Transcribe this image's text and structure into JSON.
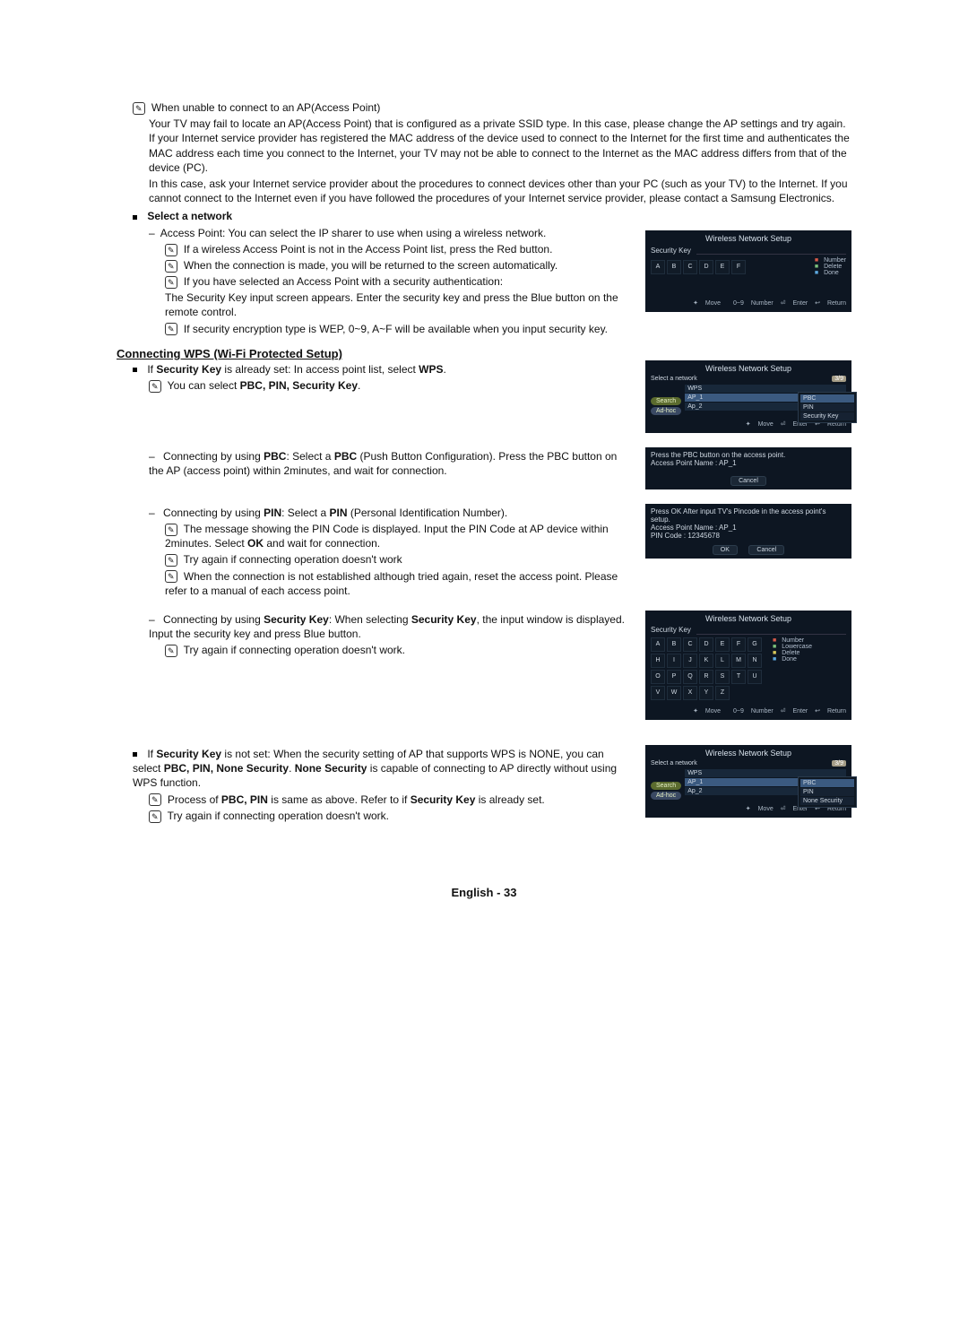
{
  "note_glyph": "✎",
  "top": {
    "unable_title": "When unable to connect to an AP(Access Point)",
    "unable_para1": "Your TV may fail to locate an AP(Access Point) that is configured as a private SSID type. In this case, please change the AP settings and try again. If your Internet service provider has registered the MAC address of the device used to connect to the Internet for the first time and authenticates the MAC address each time you connect to the Internet, your TV may not be able to connect to the Internet as the MAC address differs from that of the device (PC).",
    "unable_para2": "In this case, ask your Internet service provider about the procedures to connect devices other than your PC (such as your TV) to the Internet. If you cannot connect to the Internet even if you have followed the procedures of your Internet service provider, please contact a Samsung Electronics."
  },
  "select_network": {
    "title": "Select a network",
    "ap_line": "Access Point: You can select the IP sharer to use when using a wireless network.",
    "n1": "If a wireless Access Point is not in the Access Point list, press the Red button.",
    "n2": "When the connection is made, you will be returned to the screen automatically.",
    "n3a": "If you have selected an Access Point with a security authentication:",
    "n3b": "The Security Key input screen appears. Enter the security key and press the Blue button on the remote control.",
    "n4": "If security encryption type is WEP, 0~9, A~F will be available when you input security key."
  },
  "wps": {
    "heading": "Connecting WPS (Wi-Fi Protected Setup)",
    "intro_pre": "If ",
    "intro_bold1": "Security Key",
    "intro_mid": " is already set: In access point list, select ",
    "intro_bold2": "WPS",
    "intro_post": ".",
    "note_select": "You can select ",
    "note_select_bold": "PBC, PIN, Security Key",
    "pbc_pre": "Connecting by using ",
    "pbc_b1": "PBC",
    "pbc_mid": ": Select a ",
    "pbc_b2": "PBC",
    "pbc_post": " (Push Button Configuration). Press the PBC button on the AP (access point) within 2minutes, and wait for connection.",
    "pin_pre": "Connecting by using ",
    "pin_b1": "PIN",
    "pin_mid": ": Select a ",
    "pin_b2": "PIN",
    "pin_post": " (Personal Identification Number).",
    "pin_n1a": "The message showing the PIN Code is displayed. Input the PIN Code at AP device within 2minutes. Select ",
    "pin_n1b": "OK",
    "pin_n1c": " and wait for connection.",
    "try_again": "Try again if connecting operation doesn't work",
    "reset_note": "When the connection is not established although tried again, reset the access point. Please refer to a manual of each access point.",
    "sk_pre": "Connecting by using ",
    "sk_b1": "Security Key",
    "sk_mid": ": When selecting ",
    "sk_b2": "Security Key",
    "sk_post": ", the input window is displayed. Input the security key and press Blue button.",
    "try_again2": "Try again if connecting operation doesn't work."
  },
  "notset": {
    "pre": "If ",
    "b1": "Security Key",
    "mid1": " is not set: When the security setting of AP that supports WPS is NONE, you can select ",
    "b2": "PBC, PIN, None Security",
    "mid2": ". ",
    "b3": "None Security",
    "post": " is capable of connecting to AP directly without using WPS function.",
    "n1a": "Process of ",
    "n1b": "PBC, PIN",
    "n1c": " is same as above. Refer to if ",
    "n1d": "Security Key",
    "n1e": " is already set.",
    "n2": "Try again if connecting operation doesn't work."
  },
  "mocks": {
    "title": "Wireless Network Setup",
    "sk_label": "Security Key",
    "keys_row1": [
      "A",
      "B",
      "C",
      "D",
      "E",
      "F"
    ],
    "keys_full": [
      [
        "A",
        "B",
        "C",
        "D",
        "E",
        "F",
        "G"
      ],
      [
        "H",
        "I",
        "J",
        "K",
        "L",
        "M",
        "N"
      ],
      [
        "O",
        "P",
        "Q",
        "R",
        "S",
        "T",
        "U"
      ],
      [
        "V",
        "W",
        "X",
        "Y",
        "Z"
      ]
    ],
    "legend_number": "Number",
    "legend_lowercase": "Lowercase",
    "legend_delete": "Delete",
    "legend_done": "Done",
    "footer_move": "Move",
    "footer_number": "Number",
    "footer_enter": "Enter",
    "footer_return": "Return",
    "select_net": "Select a network",
    "count": "3/9",
    "search": "Search",
    "adhoc": "Ad-hoc",
    "ap_items": [
      "WPS",
      "AP_1",
      "Ap_2"
    ],
    "pop_pbc": "PBC",
    "pop_pin": "PIN",
    "pop_sk": "Security Key",
    "pop_none": "None Security",
    "pbc_msg": "Press the PBC button on the access point.",
    "apname_lbl": "Access Point Name : AP_1",
    "cancel": "Cancel",
    "pin_msg": "Press OK After input TV's Pincode in the access point's setup.",
    "pin_code": "PIN Code : 12345678",
    "ok": "OK",
    "num_range": "0~9"
  },
  "footer": "English - 33"
}
